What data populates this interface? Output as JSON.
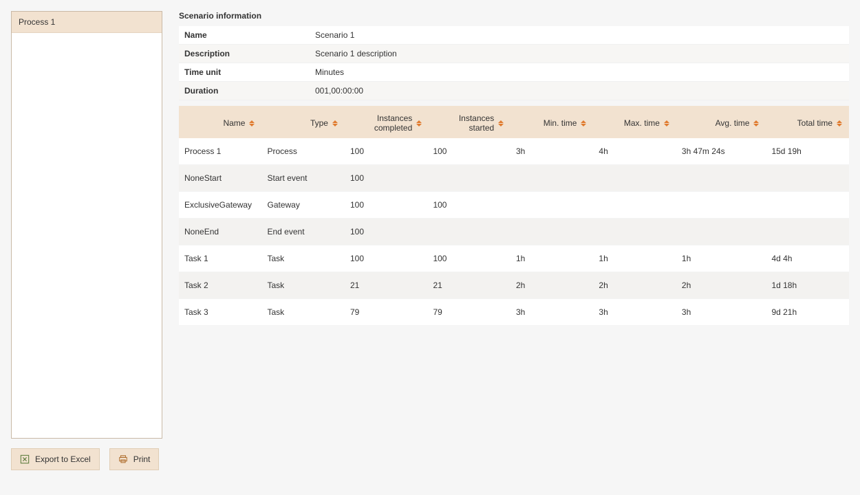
{
  "sidebar": {
    "items": [
      {
        "label": "Process 1"
      }
    ]
  },
  "actions": {
    "export": "Export to Excel",
    "print": "Print"
  },
  "scenario": {
    "title": "Scenario information",
    "fields": {
      "name_label": "Name",
      "name_value": "Scenario 1",
      "description_label": "Description",
      "description_value": "Scenario 1 description",
      "timeunit_label": "Time unit",
      "timeunit_value": "Minutes",
      "duration_label": "Duration",
      "duration_value": "001,00:00:00"
    }
  },
  "table": {
    "headers": {
      "name": "Name",
      "type": "Type",
      "instances_completed": "Instances completed",
      "instances_started": "Instances started",
      "min_time": "Min. time",
      "max_time": "Max. time",
      "avg_time": "Avg. time",
      "total_time": "Total time"
    },
    "rows": [
      {
        "name": "Process 1",
        "type": "Process",
        "icomp": "100",
        "ist": "100",
        "min": "3h",
        "max": "4h",
        "avg": "3h 47m 24s",
        "tot": "15d 19h"
      },
      {
        "name": "NoneStart",
        "type": "Start event",
        "icomp": "100",
        "ist": "",
        "min": "",
        "max": "",
        "avg": "",
        "tot": ""
      },
      {
        "name": "ExclusiveGateway",
        "type": "Gateway",
        "icomp": "100",
        "ist": "100",
        "min": "",
        "max": "",
        "avg": "",
        "tot": ""
      },
      {
        "name": "NoneEnd",
        "type": "End event",
        "icomp": "100",
        "ist": "",
        "min": "",
        "max": "",
        "avg": "",
        "tot": ""
      },
      {
        "name": "Task 1",
        "type": "Task",
        "icomp": "100",
        "ist": "100",
        "min": "1h",
        "max": "1h",
        "avg": "1h",
        "tot": "4d 4h"
      },
      {
        "name": "Task 2",
        "type": "Task",
        "icomp": "21",
        "ist": "21",
        "min": "2h",
        "max": "2h",
        "avg": "2h",
        "tot": "1d 18h"
      },
      {
        "name": "Task 3",
        "type": "Task",
        "icomp": "79",
        "ist": "79",
        "min": "3h",
        "max": "3h",
        "avg": "3h",
        "tot": "9d 21h"
      }
    ]
  }
}
